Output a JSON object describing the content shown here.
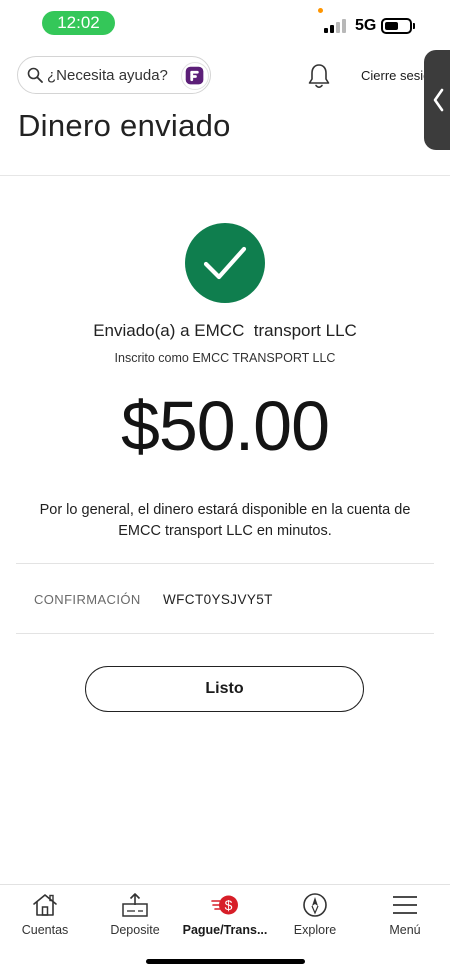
{
  "status_bar": {
    "time": "12:02",
    "network": "5G"
  },
  "header": {
    "search_placeholder": "¿Necesita ayuda?",
    "logout_label": "Cierre sesió",
    "page_title": "Dinero enviado"
  },
  "confirmation": {
    "sent_to": "Enviado(a) a EMCC  transport LLC",
    "registered_as": "Inscrito como EMCC TRANSPORT LLC",
    "amount": "$50.00",
    "availability_note": "Por lo general, el dinero estará disponible en la cuenta de\nEMCC  transport LLC en minutos.",
    "confirmation_label": "CONFIRMACIÓN",
    "confirmation_code": "WFCT0YSJVY5T",
    "done_label": "Listo"
  },
  "bottom_nav": {
    "items": [
      {
        "label": "Cuentas",
        "icon": "home-icon"
      },
      {
        "label": "Deposite",
        "icon": "deposit-icon"
      },
      {
        "label": "Pague/Trans...",
        "icon": "pay-transfer-icon"
      },
      {
        "label": "Explore",
        "icon": "compass-icon"
      },
      {
        "label": "Menú",
        "icon": "menu-icon"
      }
    ]
  },
  "colors": {
    "success_green": "#0f7e4e",
    "brand_red": "#d71e28",
    "time_pill_green": "#34c759",
    "help_logo_purple": "#5c1f78"
  }
}
